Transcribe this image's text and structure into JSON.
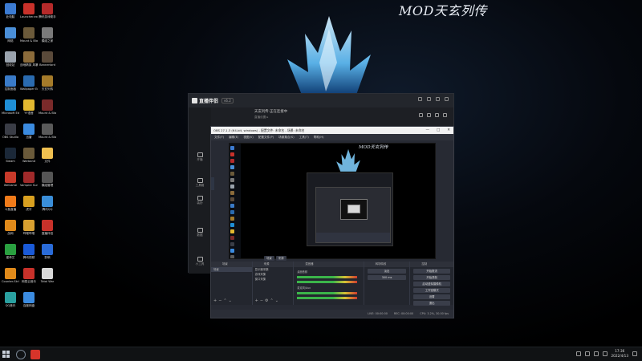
{
  "wallpaper": {
    "title": "MOD天玄列传"
  },
  "desktop_icons": [
    {
      "label": "此电脑",
      "color": "#3c7bd1"
    },
    {
      "label": "Launcher.exe 快捷方式",
      "color": "#c8312a"
    },
    {
      "label": "腾讯游戏助手",
      "color": "#b52a2a"
    },
    {
      "label": "网络",
      "color": "#4a8fd8"
    },
    {
      "label": "Mount & Blade II",
      "color": "#6b5a3a"
    },
    {
      "label": "模组之家",
      "color": "#7a7a7a"
    },
    {
      "label": "回收站",
      "color": "#9aa3ad"
    },
    {
      "label": "战地精英 风暴",
      "color": "#8b6b3a"
    },
    {
      "label": "Bannerlord",
      "color": "#5a4a3a"
    },
    {
      "label": "控制面板",
      "color": "#3a7bc8"
    },
    {
      "label": "Wallpaper Engine",
      "color": "#2a6bb0"
    },
    {
      "label": "天玄列传",
      "color": "#a57b2a"
    },
    {
      "label": "Microsoft Edge",
      "color": "#1f8fd6"
    },
    {
      "label": "YY语音",
      "color": "#e2b830"
    },
    {
      "label": "Mount & Blade",
      "color": "#7a2a2a"
    },
    {
      "label": "OBS Studio",
      "color": "#3a3d46"
    },
    {
      "label": "迅雷",
      "color": "#3b8be0"
    },
    {
      "label": "Mount & Blade 2",
      "color": "#5a5a5a"
    },
    {
      "label": "Steam",
      "color": "#1b2838"
    },
    {
      "label": "Warband",
      "color": "#6a5a3a"
    },
    {
      "label": "文件",
      "color": "#f0c050"
    },
    {
      "label": "WeGame",
      "color": "#c83a2a"
    },
    {
      "label": "Vampire Survivors",
      "color": "#a02a2a"
    },
    {
      "label": "模组管理",
      "color": "#555555"
    },
    {
      "label": "斗鱼直播",
      "color": "#f07b1a"
    },
    {
      "label": "虎牙",
      "color": "#d8a020"
    },
    {
      "label": "腾讯QQ",
      "color": "#3a8ed8"
    },
    {
      "label": "战网",
      "color": "#e08a1a"
    },
    {
      "label": "哔哩哔哩",
      "color": "#d8a030"
    },
    {
      "label": "直播伴侣",
      "color": "#c8312a"
    },
    {
      "label": "爱奇艺",
      "color": "#2aa040"
    },
    {
      "label": "腾讯视频",
      "color": "#1a5ad8"
    },
    {
      "label": "剪映",
      "color": "#2a6bd8"
    },
    {
      "label": "Counter-Strike",
      "color": "#e08a1a"
    },
    {
      "label": "网易云音乐",
      "color": "#c8312a"
    },
    {
      "label": "Total War",
      "color": "#d8d8d8"
    },
    {
      "label": "QQ音乐",
      "color": "#2aa0a0"
    },
    {
      "label": "百度网盘",
      "color": "#3b8be0"
    }
  ],
  "live_app": {
    "name": "直播伴侣",
    "version": "v6.2",
    "room_title": "天玄列传-正在连接中",
    "room_sub": "直播设置 ▸",
    "sidebar": [
      "开播",
      "工具箱",
      "装扮",
      "数据",
      "小工具"
    ]
  },
  "obs": {
    "title": "OBS 27.1.3 (64-bit, windows) - 配置文件: 未命名 - 场景: 未命名",
    "window_controls": [
      "—",
      "□",
      "✕"
    ],
    "menu": [
      "文件(F)",
      "编辑(E)",
      "视图(V)",
      "配置文件(P)",
      "场景集合(S)",
      "工具(T)",
      "帮助(H)"
    ],
    "preview_title": "MOD天玄列传",
    "scene_tabs": [
      "场景",
      "来源"
    ],
    "docks": {
      "scenes": {
        "header": "场景",
        "items": [
          "场景"
        ]
      },
      "sources": {
        "header": "来源",
        "items": [
          "显示器采集",
          "游戏采集",
          "窗口采集"
        ]
      },
      "mixer": {
        "header": "混音器",
        "channels": [
          "桌面音频",
          "麦克风/Aux"
        ]
      },
      "transitions": {
        "header": "转场特效",
        "type": "淡出",
        "duration": "300 ms"
      },
      "controls": {
        "header": "控制",
        "buttons": [
          "开始推流",
          "开始录制",
          "启动虚拟摄像机",
          "工作室模式",
          "设置",
          "退出"
        ]
      }
    },
    "status": [
      "LIVE: 00:00:00",
      "REC: 00:00:00",
      "CPU: 3.2%, 30.00 fps"
    ]
  },
  "taskbar": {
    "time": "17:36",
    "date": "2022/4/13"
  }
}
